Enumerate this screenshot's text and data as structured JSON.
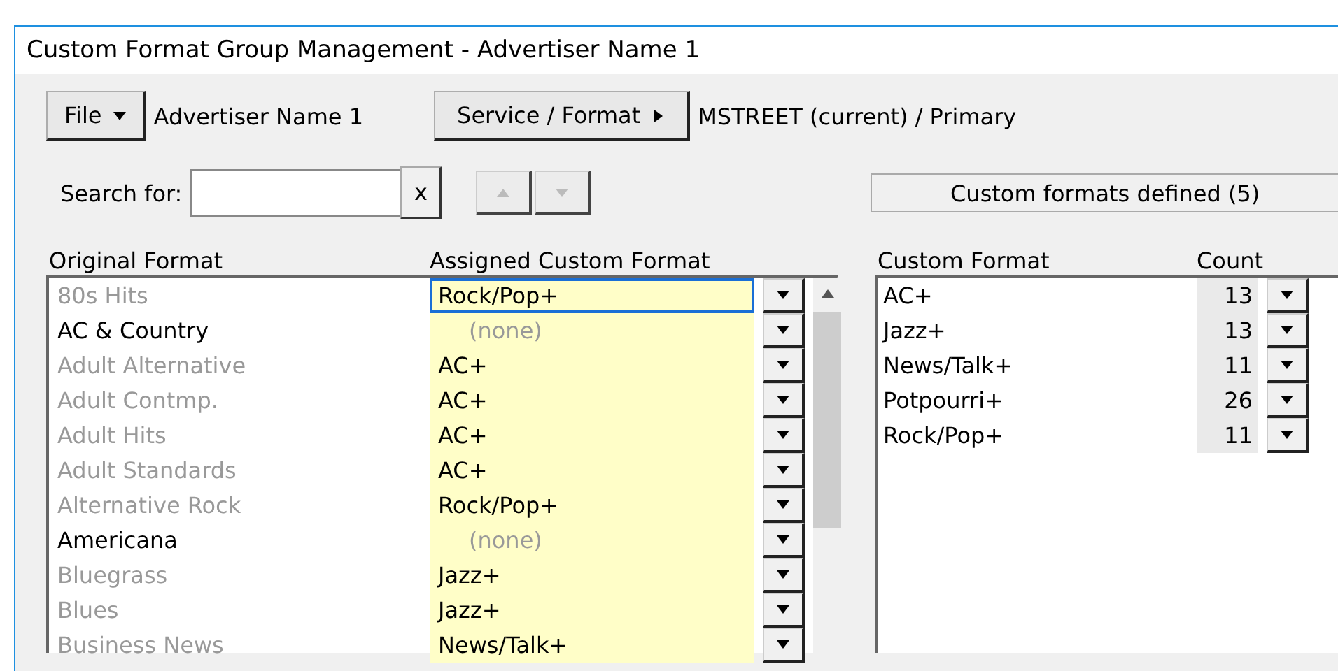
{
  "window": {
    "title": "Custom Format Group Management - Advertiser Name 1"
  },
  "toolbar": {
    "file_button": "File",
    "advertiser": "Advertiser Name 1",
    "service_button": "Service / Format",
    "service_value": "MSTREET (current) / Primary"
  },
  "search": {
    "label": "Search for:",
    "clear": "x"
  },
  "status": "Custom formats defined (5)",
  "mapping": {
    "columns": [
      "Original Format",
      "Assigned Custom Format"
    ],
    "rows": [
      {
        "original": "80s Hits",
        "active": false,
        "assigned": "Rock/Pop+",
        "assigned_set": true,
        "focused": true
      },
      {
        "original": "AC & Country",
        "active": true,
        "assigned": "(none)",
        "assigned_set": false,
        "focused": false
      },
      {
        "original": "Adult Alternative",
        "active": false,
        "assigned": "AC+",
        "assigned_set": true,
        "focused": false
      },
      {
        "original": "Adult Contmp.",
        "active": false,
        "assigned": "AC+",
        "assigned_set": true,
        "focused": false
      },
      {
        "original": "Adult Hits",
        "active": false,
        "assigned": "AC+",
        "assigned_set": true,
        "focused": false
      },
      {
        "original": "Adult Standards",
        "active": false,
        "assigned": "AC+",
        "assigned_set": true,
        "focused": false
      },
      {
        "original": "Alternative Rock",
        "active": false,
        "assigned": "Rock/Pop+",
        "assigned_set": true,
        "focused": false
      },
      {
        "original": "Americana",
        "active": true,
        "assigned": "(none)",
        "assigned_set": false,
        "focused": false
      },
      {
        "original": "Bluegrass",
        "active": false,
        "assigned": "Jazz+",
        "assigned_set": true,
        "focused": false
      },
      {
        "original": "Blues",
        "active": false,
        "assigned": "Jazz+",
        "assigned_set": true,
        "focused": false
      },
      {
        "original": "Business News",
        "active": false,
        "assigned": "News/Talk+",
        "assigned_set": true,
        "focused": false
      }
    ]
  },
  "custom": {
    "columns": [
      "Custom Format",
      "Count"
    ],
    "rows": [
      {
        "name": "AC+",
        "count": "13"
      },
      {
        "name": "Jazz+",
        "count": "13"
      },
      {
        "name": "News/Talk+",
        "count": "11"
      },
      {
        "name": "Potpourri+",
        "count": "26"
      },
      {
        "name": "Rock/Pop+",
        "count": "11"
      }
    ]
  }
}
